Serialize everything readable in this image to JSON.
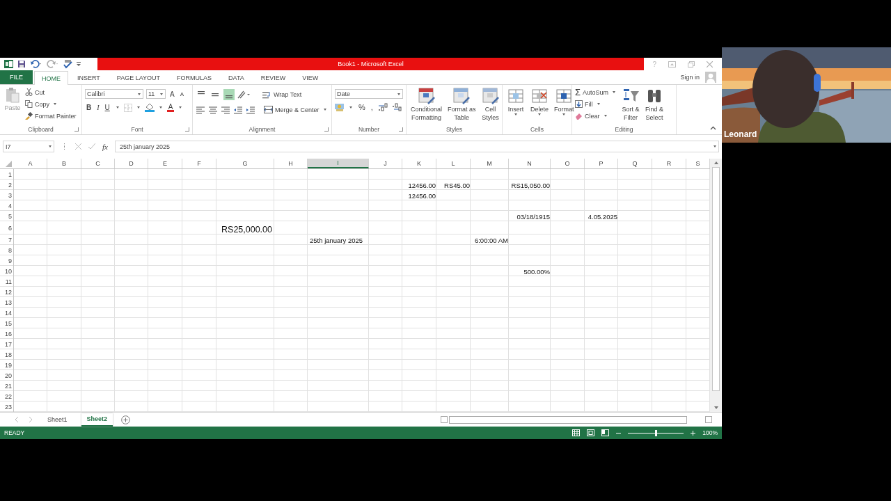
{
  "window": {
    "title": "Book1 -  Microsoft Excel",
    "help": "?"
  },
  "tabs": [
    {
      "label": "FILE",
      "kind": "file",
      "selected": false
    },
    {
      "label": "HOME",
      "kind": "tab",
      "selected": true
    },
    {
      "label": "INSERT",
      "kind": "tab",
      "selected": false
    },
    {
      "label": "PAGE LAYOUT",
      "kind": "tab",
      "selected": false
    },
    {
      "label": "FORMULAS",
      "kind": "tab",
      "selected": false
    },
    {
      "label": "DATA",
      "kind": "tab",
      "selected": false
    },
    {
      "label": "REVIEW",
      "kind": "tab",
      "selected": false
    },
    {
      "label": "VIEW",
      "kind": "tab",
      "selected": false
    }
  ],
  "account": {
    "sign_in": "Sign in"
  },
  "ribbon": {
    "clipboard": {
      "title": "Clipboard",
      "paste": {
        "label": "Paste",
        "disabled": true
      },
      "cut": "Cut",
      "copy": "Copy",
      "format_painter": "Format Painter"
    },
    "font": {
      "title": "Font",
      "name": "Calibri",
      "size": "11",
      "grow": "A",
      "shrink": "A",
      "bold": "B",
      "italic": "I",
      "underline": "U",
      "font_color": "A"
    },
    "alignment": {
      "title": "Alignment",
      "vertical": [
        {
          "selected": false
        },
        {
          "selected": false
        },
        {
          "selected": true
        }
      ],
      "wrap_text": "Wrap Text",
      "merge_center": "Merge & Center"
    },
    "number": {
      "title": "Number",
      "format": "Date",
      "percent": "%",
      "comma": ","
    },
    "styles": {
      "title": "Styles",
      "buttons": [
        {
          "lines": [
            "Conditional",
            "Formatting"
          ]
        },
        {
          "lines": [
            "Format as",
            "Table"
          ]
        },
        {
          "lines": [
            "Cell",
            "Styles"
          ]
        }
      ]
    },
    "cells": {
      "title": "Cells",
      "buttons": [
        "Insert",
        "Delete",
        "Format"
      ]
    },
    "editing": {
      "title": "Editing",
      "sigma": "Σ",
      "autosum": "AutoSum",
      "fill": "Fill",
      "clear": "Clear",
      "sort_filter": [
        "Sort &",
        "Filter"
      ],
      "find_select": [
        "Find &",
        "Select"
      ]
    }
  },
  "formula_bar": {
    "name_box": "I7",
    "function_symbol": "fx",
    "value": "25th january 2025"
  },
  "grid": {
    "columns": [
      {
        "label": "A",
        "selected": false
      },
      {
        "label": "B",
        "selected": false
      },
      {
        "label": "C",
        "selected": false
      },
      {
        "label": "D",
        "selected": false
      },
      {
        "label": "E",
        "selected": false
      },
      {
        "label": "F",
        "selected": false
      },
      {
        "label": "G",
        "selected": false
      },
      {
        "label": "H",
        "selected": false
      },
      {
        "label": "I",
        "selected": true
      },
      {
        "label": "J",
        "selected": false
      },
      {
        "label": "K",
        "selected": false
      },
      {
        "label": "L",
        "selected": false
      },
      {
        "label": "M",
        "selected": false
      },
      {
        "label": "N",
        "selected": false
      },
      {
        "label": "O",
        "selected": false
      },
      {
        "label": "P",
        "selected": false
      },
      {
        "label": "Q",
        "selected": false
      },
      {
        "label": "R",
        "selected": false
      },
      {
        "label": "S",
        "selected": false
      }
    ],
    "rows": [
      {
        "number": "1"
      },
      {
        "number": "2",
        "K": {
          "value": "12456.00",
          "kind": "number"
        },
        "L": {
          "value": "RS45.00",
          "kind": "number"
        },
        "N": {
          "value": "RS15,050.00",
          "kind": "number"
        }
      },
      {
        "number": "3",
        "K": {
          "value": "12456.00",
          "kind": "number"
        }
      },
      {
        "number": "4"
      },
      {
        "number": "5",
        "N": {
          "value": "03/18/1915",
          "kind": "number"
        },
        "P": {
          "value": "4.05.2025",
          "kind": "number"
        }
      },
      {
        "number": "6",
        "G": {
          "value": "RS25,000.00",
          "kind": "large"
        }
      },
      {
        "number": "7",
        "I": {
          "value": "25th january 2025",
          "kind": "text"
        },
        "M": {
          "value": "6:00:00 AM",
          "kind": "number"
        }
      },
      {
        "number": "8"
      },
      {
        "number": "9"
      },
      {
        "number": "10",
        "N": {
          "value": "500.00%",
          "kind": "number"
        }
      },
      {
        "number": "11"
      },
      {
        "number": "12"
      },
      {
        "number": "13"
      },
      {
        "number": "14"
      },
      {
        "number": "15"
      },
      {
        "number": "16"
      },
      {
        "number": "17"
      },
      {
        "number": "18"
      },
      {
        "number": "19"
      },
      {
        "number": "20"
      },
      {
        "number": "21"
      },
      {
        "number": "22"
      },
      {
        "number": "23"
      }
    ]
  },
  "sheets": [
    {
      "name": "Sheet1",
      "selected": false
    },
    {
      "name": "Sheet2",
      "selected": true
    }
  ],
  "status_bar": {
    "mode": "READY",
    "zoom": {
      "level": 0.5,
      "reading": "100%"
    }
  },
  "video": {
    "kind": "picture",
    "name": "Leonard"
  }
}
